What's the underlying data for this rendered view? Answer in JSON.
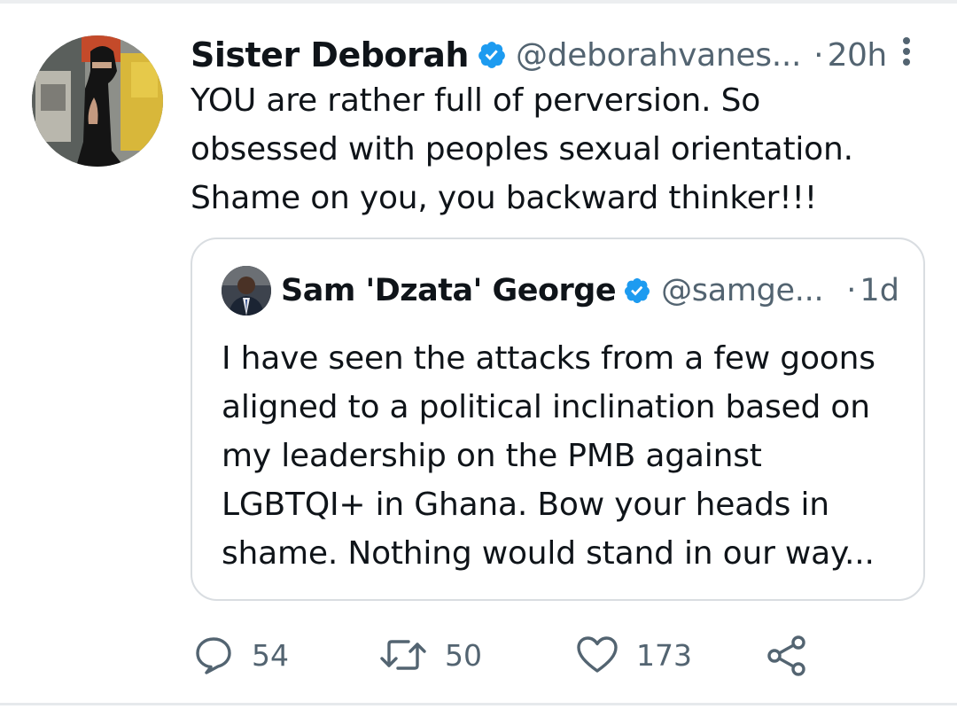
{
  "tweet": {
    "author_name": "Sister Deborah",
    "author_handle": "@deborahvanes...",
    "separator": "·",
    "time": "20h",
    "text": "YOU are rather full of perversion. So obsessed with peoples sexual orientation. Shame on you, you backward thinker!!!"
  },
  "quoted_tweet": {
    "author_name": "Sam 'Dzata' George",
    "author_handle": "@samge...",
    "separator": "·",
    "time": "1d",
    "text": "I have seen the attacks from a few goons aligned to a political inclination based on my leadership on the PMB against LGBTQI+ in Ghana. Bow your heads in shame. Nothing would stand in our way..."
  },
  "actions": {
    "reply_count": "54",
    "retweet_count": "50",
    "like_count": "173"
  },
  "icons": {
    "verified": "verified-badge-icon",
    "more": "more-vertical-icon",
    "reply": "reply-bubble-icon",
    "retweet": "retweet-icon",
    "like": "heart-icon",
    "share": "share-icon"
  },
  "colors": {
    "verified_blue": "#1d9bf0",
    "text_primary": "#0f1419",
    "text_secondary": "#536471",
    "card_border": "#d9dde1"
  }
}
